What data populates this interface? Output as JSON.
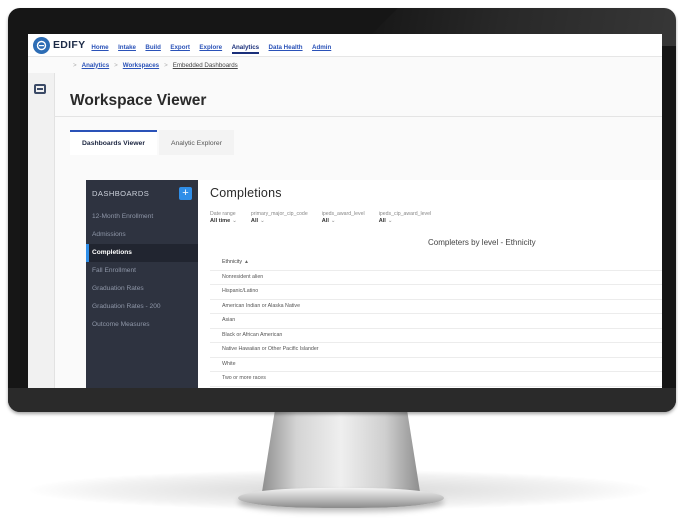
{
  "app": {
    "brand": "EDIFY",
    "nav": [
      "Home",
      "Intake",
      "Build",
      "Export",
      "Explore",
      "Analytics",
      "Data Health",
      "Admin"
    ],
    "nav_active": "Analytics"
  },
  "breadcrumb": {
    "items": [
      "Analytics",
      "Workspaces",
      "Embedded Dashboards"
    ],
    "sep": ">"
  },
  "page": {
    "title": "Workspace Viewer",
    "tabs": [
      "Dashboards Viewer",
      "Analytic Explorer"
    ]
  },
  "sidebar": {
    "heading": "DASHBOARDS",
    "add_label": "+",
    "items": [
      "12-Month Enrollment",
      "Admissions",
      "Completions",
      "Fall Enrollment",
      "Graduation Rates",
      "Graduation Rates - 200",
      "Outcome Measures"
    ],
    "active_index": 2
  },
  "dashboard": {
    "title": "Completions",
    "filters": [
      {
        "label": "Date range",
        "value": "All time"
      },
      {
        "label": "primary_major_cip_code",
        "value": "All"
      },
      {
        "label": "ipeds_award_level",
        "value": "All"
      },
      {
        "label": "ipeds_cip_award_level",
        "value": "All"
      }
    ],
    "chart_title": "Completers by level - Ethnicity",
    "table": {
      "header": "Ethnicity",
      "sort_glyph": "▲",
      "rows": [
        "Nonresident alien",
        "Hispanic/Latino",
        "American Indian or Alaska Native",
        "Asian",
        "Black or African American",
        "Native Hawaiian or Other Pacific Islander",
        "White",
        "Two or more races"
      ]
    }
  },
  "colors": {
    "accent": "#2f8ee8",
    "nav_link": "#2a52b8",
    "sidebar_bg": "#2e3340"
  }
}
